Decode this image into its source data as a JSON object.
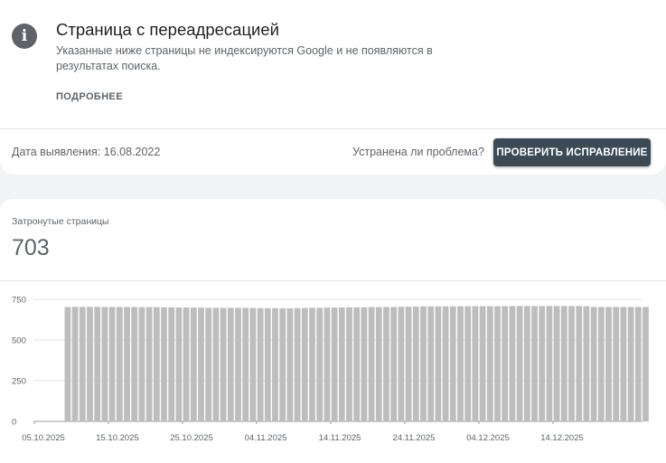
{
  "issue": {
    "title": "Страница с переадресацией",
    "description": "Указанные ниже страницы не индексируются Google и не появляются в результатах поиска.",
    "learn_more": "ПОДРОБНЕЕ",
    "detected": "Дата выявления: 16.08.2022",
    "fixed_question": "Устранена ли проблема?",
    "validate_button": "ПРОВЕРИТЬ ИСПРАВЛЕНИЕ"
  },
  "summary": {
    "label": "Затронутые страницы",
    "count": "703"
  },
  "colors": {
    "bar": "#bdbdbd",
    "button": "#3c4a56",
    "text_secondary": "#5f6368"
  },
  "chart_data": {
    "type": "bar",
    "title": "",
    "xlabel": "",
    "ylabel": "",
    "ylim": [
      0,
      750
    ],
    "yticks": [
      0,
      250,
      500,
      750
    ],
    "x_tick_labels": [
      "05.10.2025",
      "15.10.2025",
      "25.10.2025",
      "04.11.2025",
      "14.11.2025",
      "24.11.2025",
      "04.12.2025",
      "14.12.2025"
    ],
    "grid": true,
    "categories": [
      "2025-10-09",
      "2025-10-10",
      "2025-10-11",
      "2025-10-12",
      "2025-10-13",
      "2025-10-14",
      "2025-10-15",
      "2025-10-16",
      "2025-10-17",
      "2025-10-18",
      "2025-10-19",
      "2025-10-20",
      "2025-10-21",
      "2025-10-22",
      "2025-10-23",
      "2025-10-24",
      "2025-10-25",
      "2025-10-26",
      "2025-10-27",
      "2025-10-28",
      "2025-10-29",
      "2025-10-30",
      "2025-10-31",
      "2025-11-01",
      "2025-11-02",
      "2025-11-03",
      "2025-11-04",
      "2025-11-05",
      "2025-11-06",
      "2025-11-07",
      "2025-11-08",
      "2025-11-09",
      "2025-11-10",
      "2025-11-11",
      "2025-11-12",
      "2025-11-13",
      "2025-11-14",
      "2025-11-15",
      "2025-11-16",
      "2025-11-17",
      "2025-11-18",
      "2025-11-19",
      "2025-11-20",
      "2025-11-21",
      "2025-11-22",
      "2025-11-23",
      "2025-11-24",
      "2025-11-25",
      "2025-11-26",
      "2025-11-27",
      "2025-11-28",
      "2025-11-29",
      "2025-11-30",
      "2025-12-01",
      "2025-12-02",
      "2025-12-03",
      "2025-12-04",
      "2025-12-05",
      "2025-12-06",
      "2025-12-07",
      "2025-12-08",
      "2025-12-09",
      "2025-12-10",
      "2025-12-11",
      "2025-12-12",
      "2025-12-13",
      "2025-12-14",
      "2025-12-15",
      "2025-12-16",
      "2025-12-17",
      "2025-12-18",
      "2025-12-19",
      "2025-12-20",
      "2025-12-21",
      "2025-12-22",
      "2025-12-23",
      "2025-12-24",
      "2025-12-25",
      "2025-12-26"
    ],
    "values": [
      703,
      704,
      704,
      704,
      704,
      703,
      703,
      703,
      703,
      703,
      702,
      702,
      702,
      701,
      701,
      700,
      700,
      699,
      699,
      698,
      698,
      697,
      698,
      698,
      698,
      697,
      696,
      696,
      696,
      695,
      695,
      696,
      697,
      698,
      698,
      699,
      699,
      700,
      701,
      701,
      701,
      702,
      702,
      703,
      703,
      704,
      705,
      706,
      707,
      707,
      707,
      707,
      707,
      707,
      708,
      708,
      708,
      708,
      708,
      708,
      709,
      709,
      709,
      709,
      709,
      709,
      709,
      709,
      709,
      709,
      708,
      703,
      703,
      703,
      703,
      703,
      703,
      703,
      703
    ]
  }
}
